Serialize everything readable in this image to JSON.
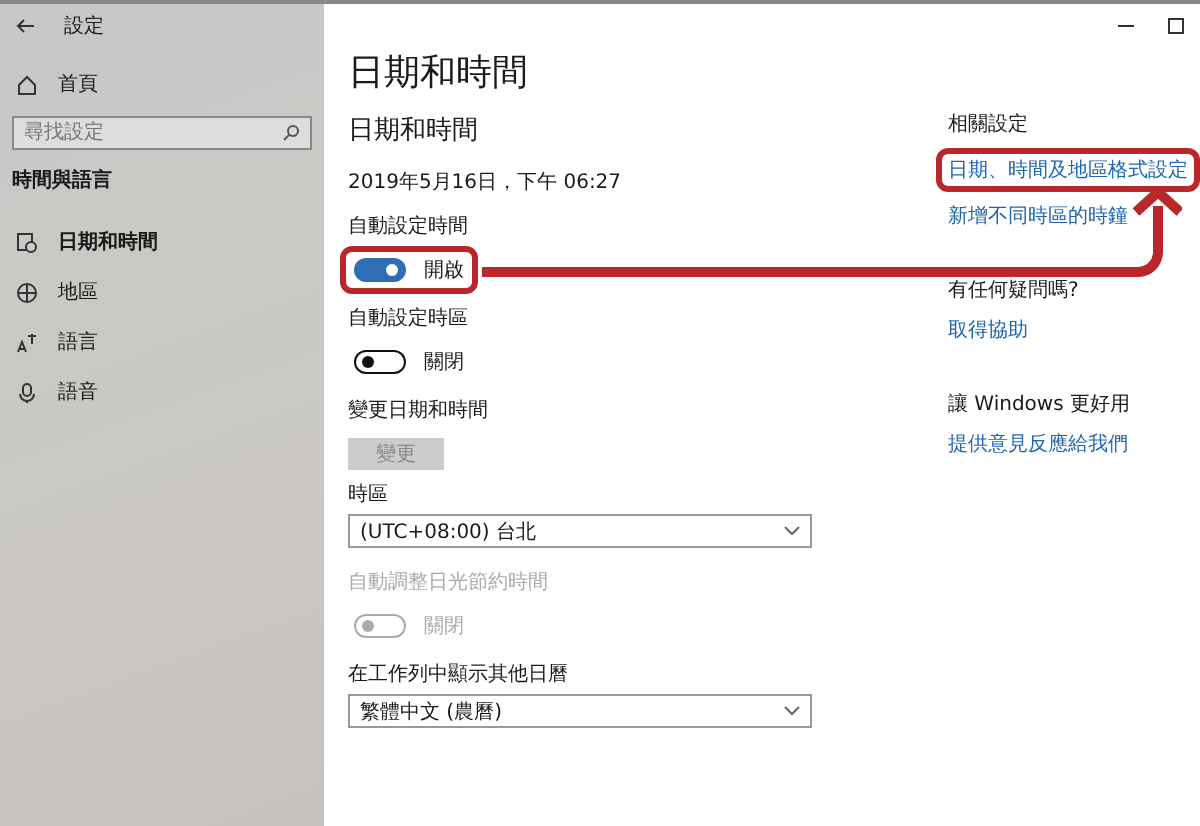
{
  "window": {
    "title": "設定"
  },
  "sidebar": {
    "home": "首頁",
    "search": {
      "placeholder": "尋找設定"
    },
    "section": "時間與語言",
    "items": [
      {
        "label": "日期和時間",
        "selected": true
      },
      {
        "label": "地區",
        "selected": false
      },
      {
        "label": "語言",
        "selected": false
      },
      {
        "label": "語音",
        "selected": false
      }
    ]
  },
  "main": {
    "title": "日期和時間",
    "subtitle": "日期和時間",
    "datetime": "2019年5月16日，下午 06:27",
    "settings": [
      {
        "kind": "toggle",
        "label": "自動設定時間",
        "on": true,
        "state_text": "開啟",
        "disabled": false,
        "highlighted": true
      },
      {
        "kind": "toggle",
        "label": "自動設定時區",
        "on": false,
        "state_text": "關閉",
        "disabled": false,
        "highlighted": false
      },
      {
        "kind": "button",
        "label": "變更日期和時間",
        "button": "變更",
        "disabled": true
      },
      {
        "kind": "select",
        "label": "時區",
        "value": "(UTC+08:00) 台北"
      },
      {
        "kind": "toggle",
        "label": "自動調整日光節約時間",
        "on": false,
        "state_text": "關閉",
        "disabled": true,
        "highlighted": false
      },
      {
        "kind": "select",
        "label": "在工作列中顯示其他日曆",
        "value": "繁體中文 (農曆)"
      }
    ]
  },
  "related": [
    {
      "heading": "相關設定",
      "links": [
        {
          "text": "日期、時間及地區格式設定",
          "highlighted": true
        },
        {
          "text": "新增不同時區的時鐘",
          "highlighted": false
        }
      ]
    },
    {
      "heading": "有任何疑問嗎?",
      "links": [
        {
          "text": "取得協助",
          "highlighted": false
        }
      ]
    },
    {
      "heading": "讓 Windows 更好用",
      "links": [
        {
          "text": "提供意見反應給我們",
          "highlighted": false
        }
      ]
    }
  ]
}
